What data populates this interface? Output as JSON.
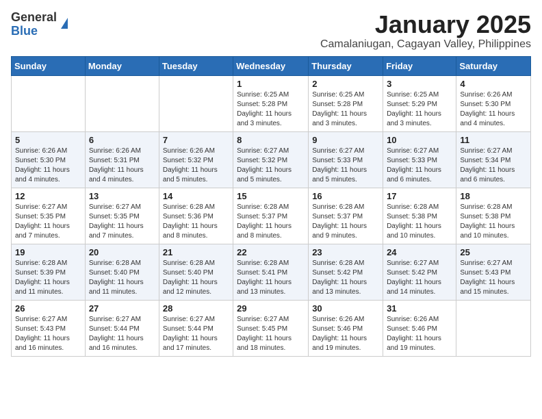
{
  "header": {
    "logo_general": "General",
    "logo_blue": "Blue",
    "month_title": "January 2025",
    "subtitle": "Camalaniugan, Cagayan Valley, Philippines"
  },
  "weekdays": [
    "Sunday",
    "Monday",
    "Tuesday",
    "Wednesday",
    "Thursday",
    "Friday",
    "Saturday"
  ],
  "weeks": [
    [
      {
        "day": "",
        "sunrise": "",
        "sunset": "",
        "daylight": ""
      },
      {
        "day": "",
        "sunrise": "",
        "sunset": "",
        "daylight": ""
      },
      {
        "day": "",
        "sunrise": "",
        "sunset": "",
        "daylight": ""
      },
      {
        "day": "1",
        "sunrise": "Sunrise: 6:25 AM",
        "sunset": "Sunset: 5:28 PM",
        "daylight": "Daylight: 11 hours and 3 minutes."
      },
      {
        "day": "2",
        "sunrise": "Sunrise: 6:25 AM",
        "sunset": "Sunset: 5:28 PM",
        "daylight": "Daylight: 11 hours and 3 minutes."
      },
      {
        "day": "3",
        "sunrise": "Sunrise: 6:25 AM",
        "sunset": "Sunset: 5:29 PM",
        "daylight": "Daylight: 11 hours and 3 minutes."
      },
      {
        "day": "4",
        "sunrise": "Sunrise: 6:26 AM",
        "sunset": "Sunset: 5:30 PM",
        "daylight": "Daylight: 11 hours and 4 minutes."
      }
    ],
    [
      {
        "day": "5",
        "sunrise": "Sunrise: 6:26 AM",
        "sunset": "Sunset: 5:30 PM",
        "daylight": "Daylight: 11 hours and 4 minutes."
      },
      {
        "day": "6",
        "sunrise": "Sunrise: 6:26 AM",
        "sunset": "Sunset: 5:31 PM",
        "daylight": "Daylight: 11 hours and 4 minutes."
      },
      {
        "day": "7",
        "sunrise": "Sunrise: 6:26 AM",
        "sunset": "Sunset: 5:32 PM",
        "daylight": "Daylight: 11 hours and 5 minutes."
      },
      {
        "day": "8",
        "sunrise": "Sunrise: 6:27 AM",
        "sunset": "Sunset: 5:32 PM",
        "daylight": "Daylight: 11 hours and 5 minutes."
      },
      {
        "day": "9",
        "sunrise": "Sunrise: 6:27 AM",
        "sunset": "Sunset: 5:33 PM",
        "daylight": "Daylight: 11 hours and 5 minutes."
      },
      {
        "day": "10",
        "sunrise": "Sunrise: 6:27 AM",
        "sunset": "Sunset: 5:33 PM",
        "daylight": "Daylight: 11 hours and 6 minutes."
      },
      {
        "day": "11",
        "sunrise": "Sunrise: 6:27 AM",
        "sunset": "Sunset: 5:34 PM",
        "daylight": "Daylight: 11 hours and 6 minutes."
      }
    ],
    [
      {
        "day": "12",
        "sunrise": "Sunrise: 6:27 AM",
        "sunset": "Sunset: 5:35 PM",
        "daylight": "Daylight: 11 hours and 7 minutes."
      },
      {
        "day": "13",
        "sunrise": "Sunrise: 6:27 AM",
        "sunset": "Sunset: 5:35 PM",
        "daylight": "Daylight: 11 hours and 7 minutes."
      },
      {
        "day": "14",
        "sunrise": "Sunrise: 6:28 AM",
        "sunset": "Sunset: 5:36 PM",
        "daylight": "Daylight: 11 hours and 8 minutes."
      },
      {
        "day": "15",
        "sunrise": "Sunrise: 6:28 AM",
        "sunset": "Sunset: 5:37 PM",
        "daylight": "Daylight: 11 hours and 8 minutes."
      },
      {
        "day": "16",
        "sunrise": "Sunrise: 6:28 AM",
        "sunset": "Sunset: 5:37 PM",
        "daylight": "Daylight: 11 hours and 9 minutes."
      },
      {
        "day": "17",
        "sunrise": "Sunrise: 6:28 AM",
        "sunset": "Sunset: 5:38 PM",
        "daylight": "Daylight: 11 hours and 10 minutes."
      },
      {
        "day": "18",
        "sunrise": "Sunrise: 6:28 AM",
        "sunset": "Sunset: 5:38 PM",
        "daylight": "Daylight: 11 hours and 10 minutes."
      }
    ],
    [
      {
        "day": "19",
        "sunrise": "Sunrise: 6:28 AM",
        "sunset": "Sunset: 5:39 PM",
        "daylight": "Daylight: 11 hours and 11 minutes."
      },
      {
        "day": "20",
        "sunrise": "Sunrise: 6:28 AM",
        "sunset": "Sunset: 5:40 PM",
        "daylight": "Daylight: 11 hours and 11 minutes."
      },
      {
        "day": "21",
        "sunrise": "Sunrise: 6:28 AM",
        "sunset": "Sunset: 5:40 PM",
        "daylight": "Daylight: 11 hours and 12 minutes."
      },
      {
        "day": "22",
        "sunrise": "Sunrise: 6:28 AM",
        "sunset": "Sunset: 5:41 PM",
        "daylight": "Daylight: 11 hours and 13 minutes."
      },
      {
        "day": "23",
        "sunrise": "Sunrise: 6:28 AM",
        "sunset": "Sunset: 5:42 PM",
        "daylight": "Daylight: 11 hours and 13 minutes."
      },
      {
        "day": "24",
        "sunrise": "Sunrise: 6:27 AM",
        "sunset": "Sunset: 5:42 PM",
        "daylight": "Daylight: 11 hours and 14 minutes."
      },
      {
        "day": "25",
        "sunrise": "Sunrise: 6:27 AM",
        "sunset": "Sunset: 5:43 PM",
        "daylight": "Daylight: 11 hours and 15 minutes."
      }
    ],
    [
      {
        "day": "26",
        "sunrise": "Sunrise: 6:27 AM",
        "sunset": "Sunset: 5:43 PM",
        "daylight": "Daylight: 11 hours and 16 minutes."
      },
      {
        "day": "27",
        "sunrise": "Sunrise: 6:27 AM",
        "sunset": "Sunset: 5:44 PM",
        "daylight": "Daylight: 11 hours and 16 minutes."
      },
      {
        "day": "28",
        "sunrise": "Sunrise: 6:27 AM",
        "sunset": "Sunset: 5:44 PM",
        "daylight": "Daylight: 11 hours and 17 minutes."
      },
      {
        "day": "29",
        "sunrise": "Sunrise: 6:27 AM",
        "sunset": "Sunset: 5:45 PM",
        "daylight": "Daylight: 11 hours and 18 minutes."
      },
      {
        "day": "30",
        "sunrise": "Sunrise: 6:26 AM",
        "sunset": "Sunset: 5:46 PM",
        "daylight": "Daylight: 11 hours and 19 minutes."
      },
      {
        "day": "31",
        "sunrise": "Sunrise: 6:26 AM",
        "sunset": "Sunset: 5:46 PM",
        "daylight": "Daylight: 11 hours and 19 minutes."
      },
      {
        "day": "",
        "sunrise": "",
        "sunset": "",
        "daylight": ""
      }
    ]
  ]
}
